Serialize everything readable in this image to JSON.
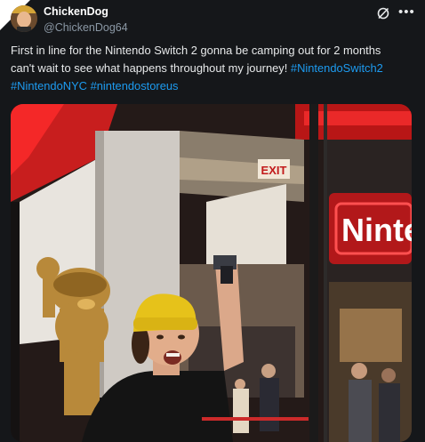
{
  "post": {
    "display_name": "ChickenDog",
    "handle": "@ChickenDog64",
    "text_line1": "First in line for the Nintendo Switch 2 gonna be camping out for 2 months",
    "text_line2": "can't wait to see what happens throughout my journey!",
    "hashtags": [
      "#NintendoSwitch2",
      "#NintendoNYC",
      "#nintendostoreus"
    ]
  },
  "media": {
    "store_sign": "Ninte",
    "exit_sign": "EXIT"
  },
  "icons": {
    "grok": "grok-icon",
    "more": "more-icon"
  },
  "colors": {
    "background": "#15171a",
    "text": "#e7e9ea",
    "handle": "#8b98a5",
    "hashtag": "#1d9bf0"
  }
}
